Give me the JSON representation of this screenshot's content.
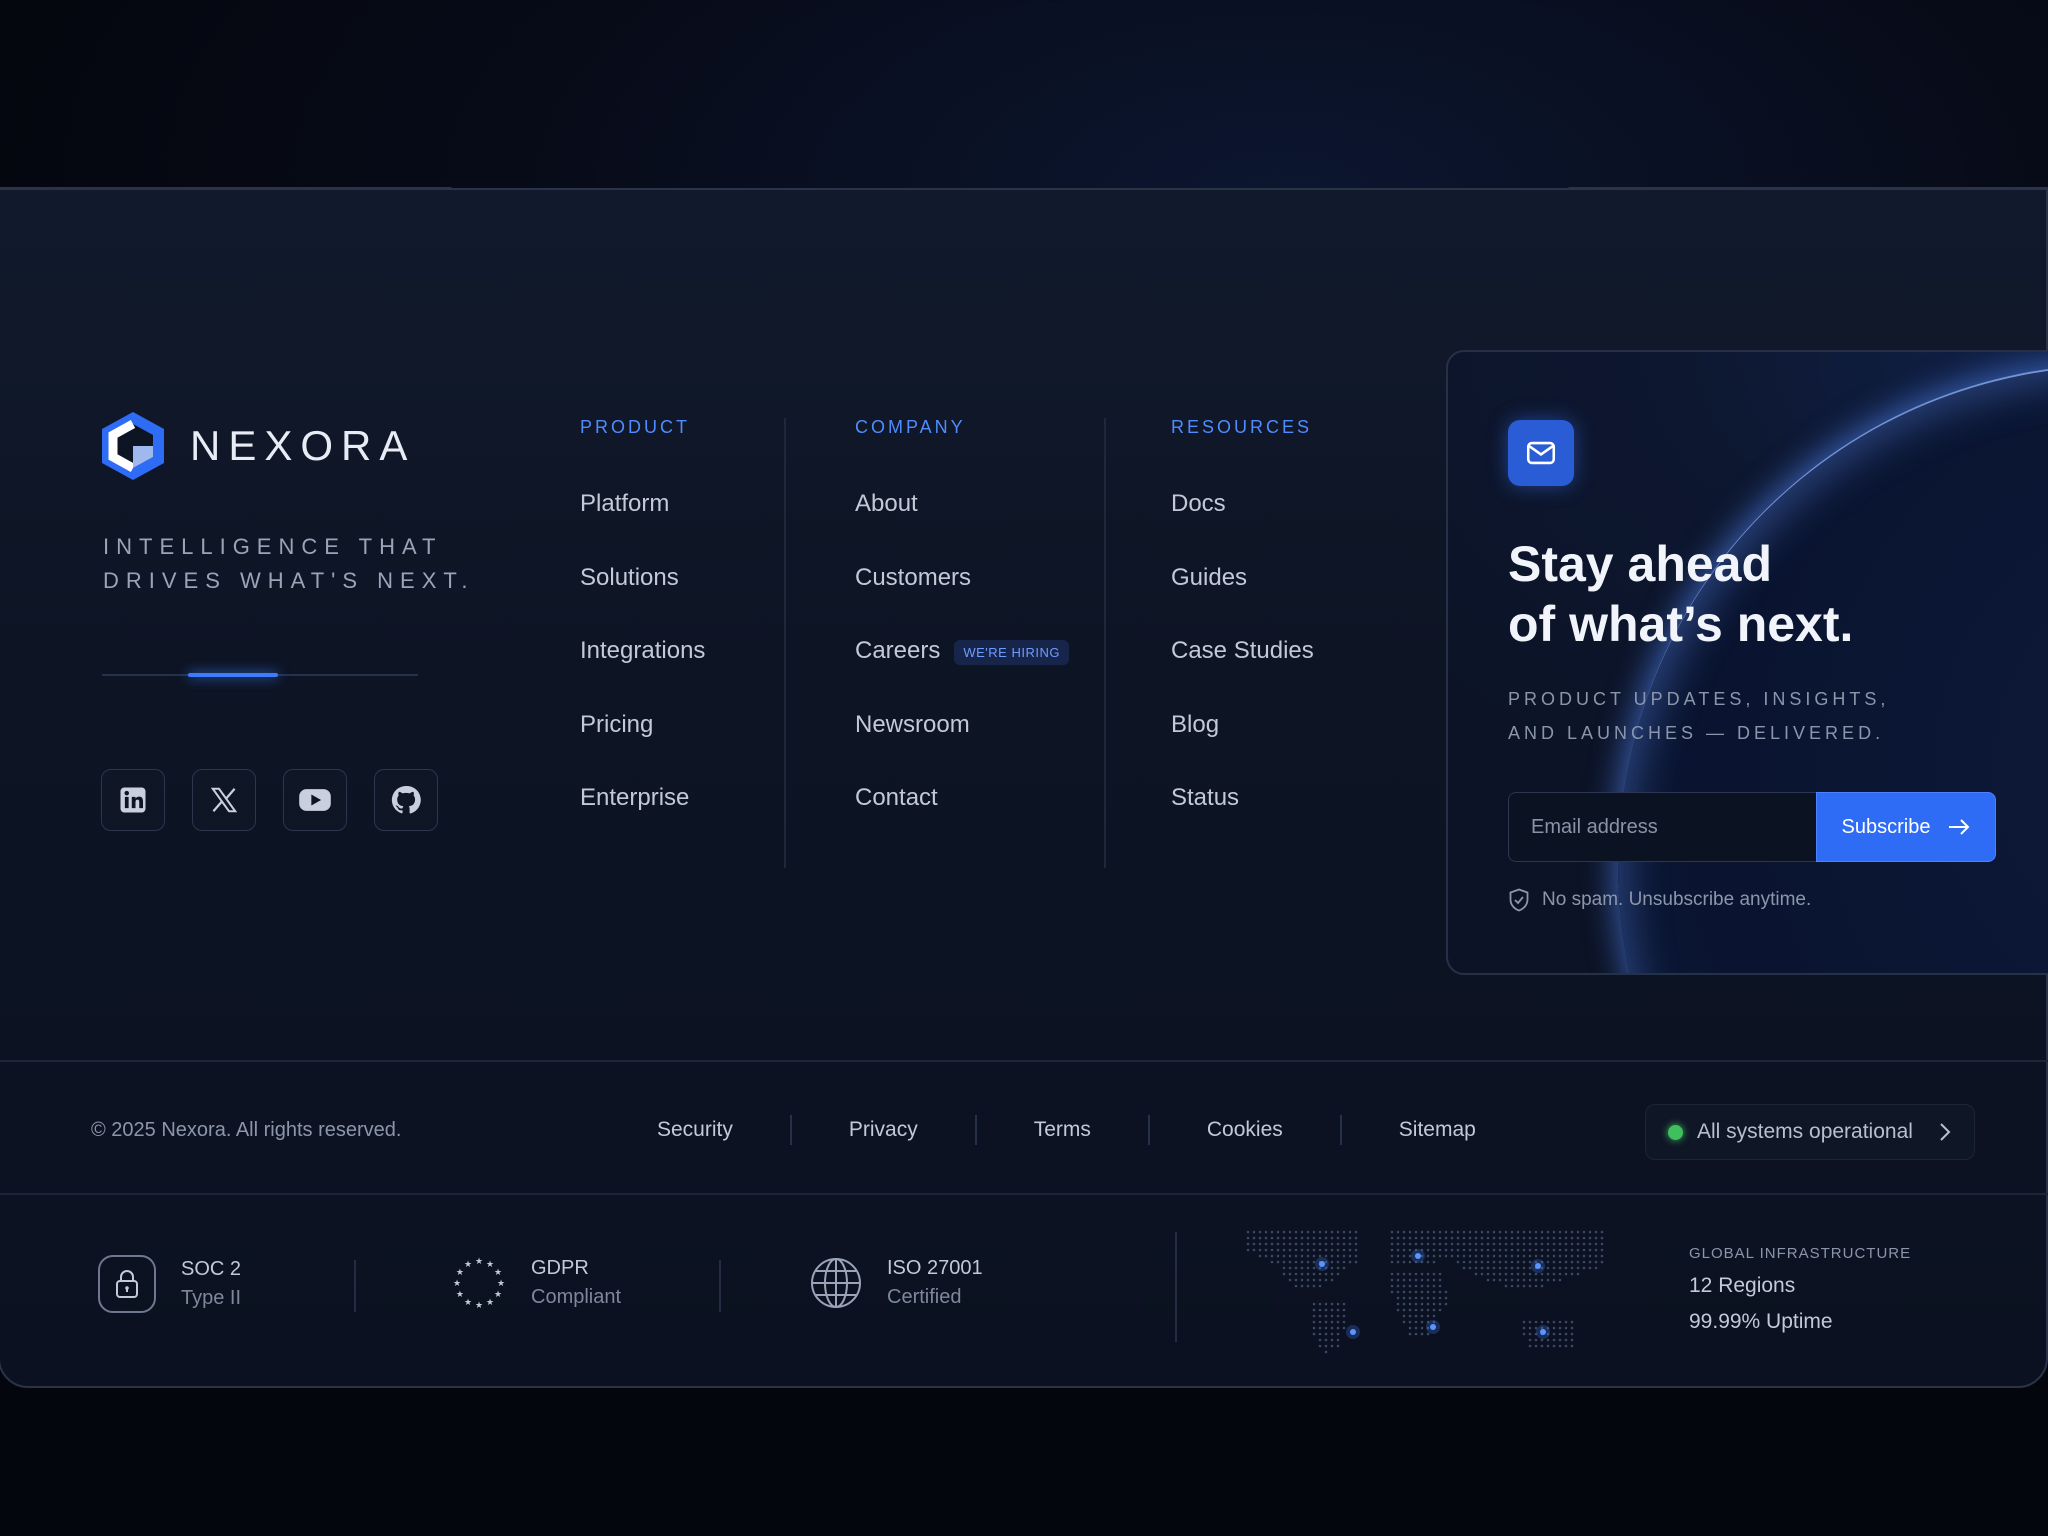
{
  "brand": {
    "name": "NEXORA",
    "tagline": "Intelligence that\ndrives what's next.",
    "accent_color": "#3d7bff"
  },
  "socials": [
    {
      "name": "linkedin-icon"
    },
    {
      "name": "x-icon"
    },
    {
      "name": "youtube-icon"
    },
    {
      "name": "github-icon"
    }
  ],
  "columns": {
    "product": {
      "heading": "PRODUCT",
      "items": [
        "Platform",
        "Solutions",
        "Integrations",
        "Pricing",
        "Enterprise"
      ]
    },
    "company": {
      "heading": "COMPANY",
      "items": [
        "About",
        "Customers",
        "Careers",
        "Newsroom",
        "Contact"
      ],
      "careers_badge": "WE'RE HIRING"
    },
    "resources": {
      "heading": "RESOURCES",
      "items": [
        "Docs",
        "Guides",
        "Case Studies",
        "Blog",
        "Status"
      ]
    }
  },
  "newsletter": {
    "icon": "mail-icon",
    "title": "Stay ahead\nof what’s next.",
    "subtitle": "Product updates, insights,\nand launches — delivered.",
    "email_placeholder": "Email address",
    "email_value": "",
    "subscribe_label": "Subscribe",
    "note": "No spam. Unsubscribe anytime."
  },
  "bottom": {
    "copyright": "© 2025 Nexora. All rights reserved.",
    "legal_links": [
      "Security",
      "Privacy",
      "Terms",
      "Cookies",
      "Sitemap"
    ],
    "status_text": "All systems operational",
    "status_color": "#3fbf5e"
  },
  "compliance": [
    {
      "icon": "lock-icon",
      "title": "SOC 2",
      "sub": "Type II"
    },
    {
      "icon": "eu-stars-icon",
      "title": "GDPR",
      "sub": "Compliant"
    },
    {
      "icon": "globe-icon",
      "title": "ISO 27001",
      "sub": "Certified"
    }
  ],
  "infrastructure": {
    "label": "GLOBAL INFRASTRUCTURE",
    "regions": "12 Regions",
    "uptime": "99.99% Uptime"
  }
}
